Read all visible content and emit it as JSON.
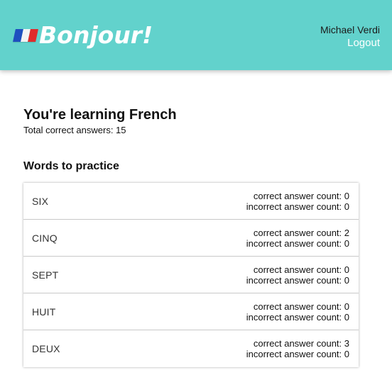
{
  "colors": {
    "accent": "#62d2cc",
    "flag_blue": "#1e4fbf",
    "flag_white": "#f3f3f3",
    "flag_red": "#e02b2b"
  },
  "header": {
    "brand": "Bonjour!",
    "logo_icon": "french-flag-icon",
    "user_name": "Michael Verdi",
    "logout_label": "Logout"
  },
  "main": {
    "title": "You're learning French",
    "total_label": "Total correct answers: 15",
    "section_title": "Words to practice",
    "words": [
      {
        "word": "SIX",
        "correct": "correct answer count: 0",
        "incorrect": "incorrect answer count: 0"
      },
      {
        "word": "CINQ",
        "correct": "correct answer count: 2",
        "incorrect": "incorrect answer count: 0"
      },
      {
        "word": "SEPT",
        "correct": "correct answer count: 0",
        "incorrect": "incorrect answer count: 0"
      },
      {
        "word": "HUIT",
        "correct": "correct answer count: 0",
        "incorrect": "incorrect answer count: 0"
      },
      {
        "word": "DEUX",
        "correct": "correct answer count: 3",
        "incorrect": "incorrect answer count: 0"
      }
    ]
  }
}
